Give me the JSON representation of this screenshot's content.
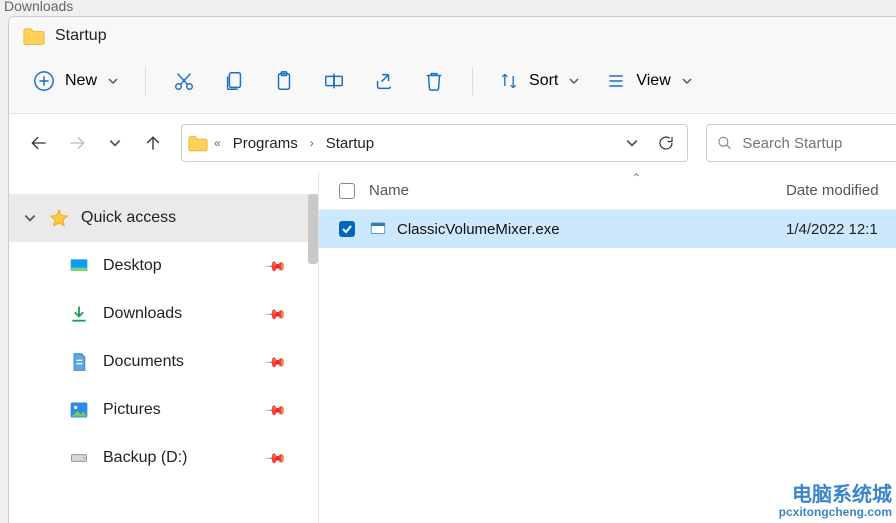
{
  "outer_label": "Downloads",
  "window": {
    "title": "Startup"
  },
  "toolbar": {
    "new_label": "New",
    "sort_label": "Sort",
    "view_label": "View"
  },
  "breadcrumb": {
    "items": [
      "Programs",
      "Startup"
    ]
  },
  "search": {
    "placeholder": "Search Startup"
  },
  "sidebar": {
    "header": "Quick access",
    "items": [
      {
        "label": "Desktop",
        "icon": "desktop"
      },
      {
        "label": "Downloads",
        "icon": "downloads"
      },
      {
        "label": "Documents",
        "icon": "documents"
      },
      {
        "label": "Pictures",
        "icon": "pictures"
      },
      {
        "label": "Backup (D:)",
        "icon": "drive"
      }
    ]
  },
  "columns": {
    "name": "Name",
    "date": "Date modified"
  },
  "files": [
    {
      "name": "ClassicVolumeMixer.exe",
      "date": "1/4/2022 12:1"
    }
  ],
  "watermark": {
    "cn": "电脑系统城",
    "url": "pcxitongcheng.com"
  }
}
